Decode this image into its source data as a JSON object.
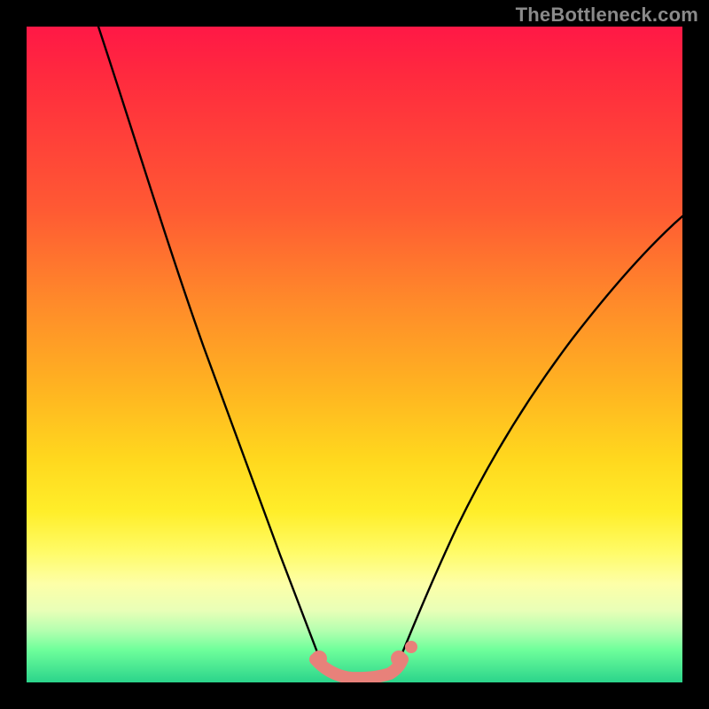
{
  "watermark": "TheBottleneck.com",
  "chart_data": {
    "type": "line",
    "title": "",
    "xlabel": "",
    "ylabel": "",
    "xlim": [
      0,
      100
    ],
    "ylim": [
      0,
      100
    ],
    "background_gradient": {
      "top": "#ff1846",
      "upper_mid": "#ff8a2a",
      "mid": "#ffe424",
      "lower_mid": "#fdffa8",
      "bottom": "#2bd48b"
    },
    "series": [
      {
        "name": "left-branch",
        "color": "#000000",
        "x": [
          11,
          16,
          21,
          26,
          30,
          34,
          37,
          40,
          42.5,
          44.5
        ],
        "y": [
          100,
          84,
          68,
          53,
          40,
          29,
          20,
          12.5,
          7,
          3.5
        ]
      },
      {
        "name": "right-branch",
        "color": "#000000",
        "x": [
          56.5,
          60,
          65,
          71,
          78,
          86,
          94,
          100
        ],
        "y": [
          3.5,
          8,
          16,
          26,
          37,
          48,
          57,
          63
        ]
      },
      {
        "name": "valley-floor",
        "color": "#e8817a",
        "x": [
          44,
          46,
          49,
          52,
          55,
          57
        ],
        "y": [
          3.2,
          1.2,
          0.4,
          0.4,
          1.2,
          3.2
        ]
      }
    ],
    "markers": [
      {
        "name": "left-endpoint",
        "x": 44.5,
        "y": 3.4,
        "color": "#e8817a",
        "r": 6
      },
      {
        "name": "right-endpoint",
        "x": 56.5,
        "y": 3.4,
        "color": "#e8817a",
        "r": 6
      },
      {
        "name": "right-gap-dot",
        "x": 58.4,
        "y": 5.6,
        "color": "#e8817a",
        "r": 5
      }
    ]
  }
}
